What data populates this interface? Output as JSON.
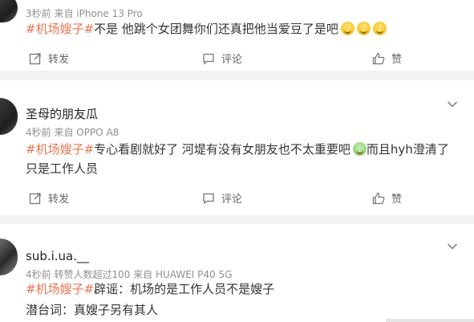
{
  "posts": [
    {
      "meta": "3秒前 来自 iPhone 13 Pro",
      "tag": "#机场嫂子#",
      "text": "不是 他跳个女团舞你们还真把他当爱豆了是吧",
      "actions": {
        "share": "转发",
        "comment": "评论",
        "like": "赞"
      }
    },
    {
      "name": "圣母的朋友瓜",
      "meta": "4秒前 来自 OPPO A8",
      "tag": "#机场嫂子#",
      "text": "专心看剧就好了 河堤有没有女朋友也不太重要吧",
      "text2": "而且hyh澄清了只是工作人员",
      "actions": {
        "share": "转发",
        "comment": "评论",
        "like": "赞"
      }
    },
    {
      "name": "sub.i.ua.__",
      "meta": "4秒前 转赞人数超过100 来自 HUAWEI P40 5G",
      "tag": "#机场嫂子#",
      "text": "辟谣：机场的是工作人员不是嫂子",
      "line2": "潜台词：真嫂子另有其人"
    }
  ]
}
